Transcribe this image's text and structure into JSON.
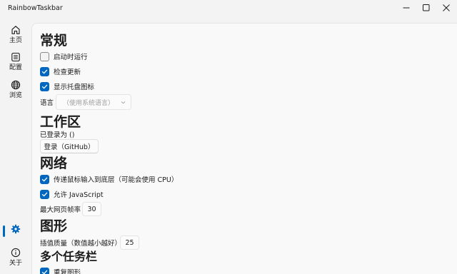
{
  "window": {
    "title": "RainbowTaskbar"
  },
  "nav": {
    "home": "主页",
    "config": "配置",
    "browse": "浏览",
    "about": "关于"
  },
  "sections": {
    "general": {
      "heading": "常规",
      "autostart_label": "启动时运行",
      "autostart_checked": false,
      "check_updates_label": "检查更新",
      "check_updates_checked": true,
      "tray_icon_label": "显示托盘图标",
      "tray_icon_checked": true,
      "language_label": "语言",
      "language_value": "（使用系统语言）"
    },
    "workshop": {
      "heading": "工作区",
      "logged_in_as": "已登录为 ()",
      "login_button": "登录（GitHub）"
    },
    "network": {
      "heading": "网络",
      "pass_mouse_label": "传递鼠标输入到底层（可能会使用 CPU）",
      "pass_mouse_checked": true,
      "allow_js_label": "允许 JavaScript",
      "allow_js_checked": true,
      "max_fps_label": "最大网页帧率",
      "max_fps_value": "30"
    },
    "graphics": {
      "heading": "图形",
      "interp_label": "插值质量（数值越小越好）",
      "interp_value": "25"
    },
    "multi_taskbar": {
      "heading": "多个任务栏",
      "redraw_label": "重复图形",
      "redraw_checked": true
    }
  },
  "colors": {
    "accent": "#0067c0",
    "background": "#f3f3f3",
    "content_background": "#f9f9f9"
  },
  "icons": {
    "home": "home-icon",
    "config": "list-icon",
    "browse": "globe-icon",
    "settings": "gear-icon",
    "about": "info-icon"
  }
}
